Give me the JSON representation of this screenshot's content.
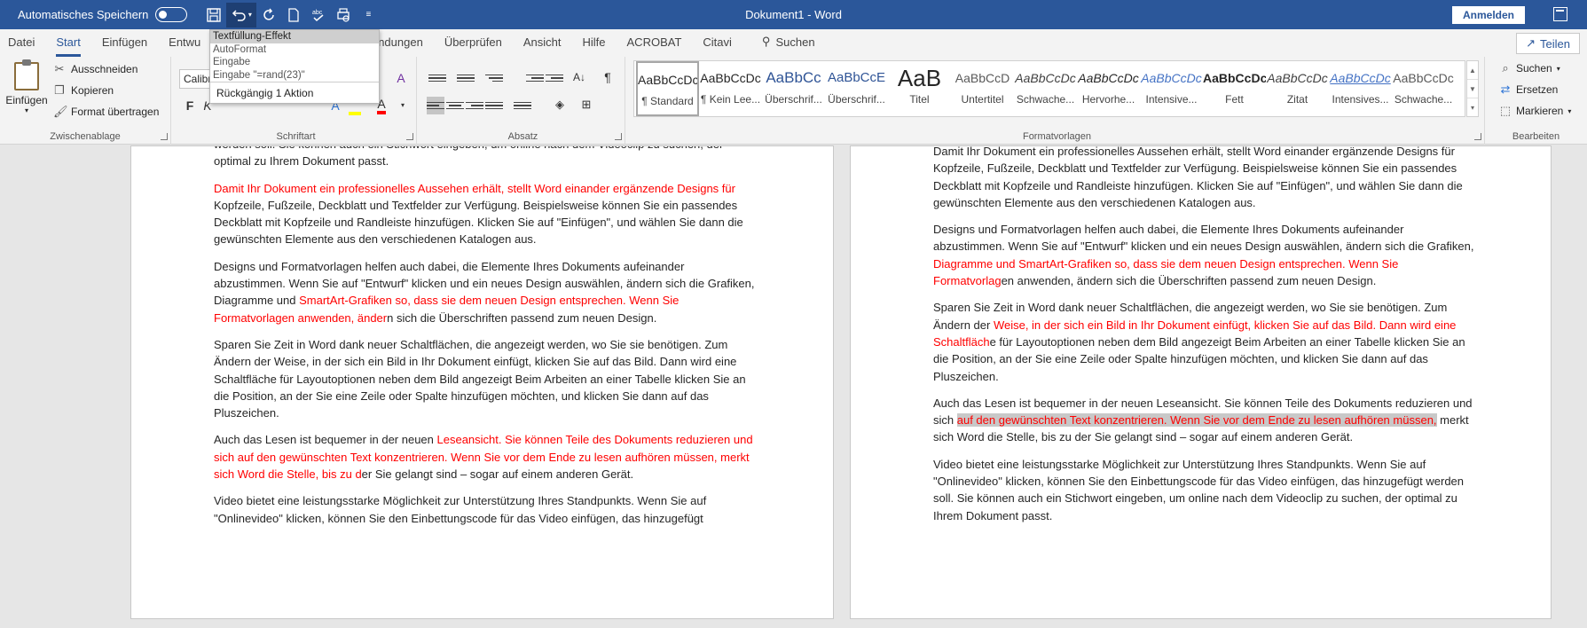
{
  "titlebar": {
    "autosave_label": "Automatisches Speichern",
    "doc_title": "Dokument1  -  Word",
    "signin_label": "Anmelden"
  },
  "undo_dropdown": {
    "items": [
      "Textfüllung-Effekt",
      "AutoFormat",
      "Eingabe",
      "Eingabe \"=rand(23)\""
    ],
    "status": "Rückgängig 1 Aktion"
  },
  "tabs": [
    "Datei",
    "Start",
    "Einfügen",
    "Entwu",
    "Sendungen",
    "Überprüfen",
    "Ansicht",
    "Hilfe",
    "ACROBAT",
    "Citavi"
  ],
  "search_label": "Suchen",
  "share_label": "Teilen",
  "clipboard": {
    "paste_label": "Einfügen",
    "cut_label": "Ausschneiden",
    "copy_label": "Kopieren",
    "format_painter_label": "Format übertragen",
    "group_label": "Zwischenablage"
  },
  "font": {
    "font_name": "Calibri",
    "bold": "F",
    "italic": "K",
    "group_label": "Schriftart"
  },
  "paragraph": {
    "group_label": "Absatz"
  },
  "styles": {
    "group_label": "Formatvorlagen",
    "items": [
      {
        "sample": "AaBbCcDc",
        "name": "¶ Standard"
      },
      {
        "sample": "AaBbCcDc",
        "name": "¶ Kein Lee..."
      },
      {
        "sample": "AaBbCc",
        "name": "Überschrif..."
      },
      {
        "sample": "AaBbCcE",
        "name": "Überschrif..."
      },
      {
        "sample": "AaB",
        "name": "Titel"
      },
      {
        "sample": "AaBbCcD",
        "name": "Untertitel"
      },
      {
        "sample": "AaBbCcDc",
        "name": "Schwache..."
      },
      {
        "sample": "AaBbCcDc",
        "name": "Hervorhe..."
      },
      {
        "sample": "AaBbCcDc",
        "name": "Intensive..."
      },
      {
        "sample": "AaBbCcDc",
        "name": "Fett"
      },
      {
        "sample": "AaBbCcDc",
        "name": "Zitat"
      },
      {
        "sample": "AaBbCcDc",
        "name": "Intensives..."
      },
      {
        "sample": "AaBbCcDc",
        "name": "Schwache..."
      }
    ]
  },
  "editing": {
    "find_label": "Suchen",
    "replace_label": "Ersetzen",
    "select_label": "Markieren",
    "group_label": "Bearbeiten"
  },
  "colors": {
    "titlebar": "#2b579a",
    "tracked_text": "#ff0000",
    "highlight": "#c8c8c8"
  },
  "left_page": {
    "p0": "werden soll. Sie können auch ein Stichwort eingeben, um online nach dem Videoclip zu suchen, der optimal zu Ihrem Dokument passt.",
    "p1_red": "Damit Ihr Dokument ein professionelles Aussehen erhält, stellt Word einander ergänzende Designs für",
    "p1_rest": " Kopfzeile, Fußzeile, Deckblatt und Textfelder zur Verfügung. Beispielsweise können Sie ein passendes Deckblatt mit Kopfzeile und Randleiste hinzufügen. Klicken Sie auf \"Einfügen\", und wählen Sie dann die gewünschten Elemente aus den verschiedenen Katalogen aus.",
    "p2_a": "Designs und Formatvorlagen helfen auch dabei, die Elemente Ihres Dokuments aufeinander abzustimmen. Wenn Sie auf \"Entwurf\" klicken und ein neues Design auswählen, ändern sich die Grafiken, Diagramme und ",
    "p2_red": "SmartArt-Grafiken so, dass sie dem neuen Design entsprechen. Wenn Sie Formatvorlagen anwenden, änder",
    "p2_b": "n sich die Überschriften passend zum neuen Design.",
    "p3": "Sparen Sie Zeit in Word dank neuer Schaltflächen, die angezeigt werden, wo Sie sie benötigen. Zum Ändern der Weise, in der sich ein Bild in Ihr Dokument einfügt, klicken Sie auf das Bild. Dann wird eine Schaltfläche für Layoutoptionen neben dem Bild angezeigt Beim Arbeiten an einer Tabelle klicken Sie an die Position, an der Sie eine Zeile oder Spalte hinzufügen möchten, und klicken Sie dann auf das Pluszeichen.",
    "p4_a": "Auch das Lesen ist bequemer in der neuen ",
    "p4_red": "Leseansicht. Sie können Teile des Dokuments reduzieren und sich auf den gewünschten Text konzentrieren. Wenn Sie vor dem Ende zu lesen aufhören müssen, merkt sich Word die Stelle, bis zu d",
    "p4_b": "er Sie gelangt sind – sogar auf einem anderen Gerät.",
    "p5": "Video bietet eine leistungsstarke Möglichkeit zur Unterstützung Ihres Standpunkts. Wenn Sie auf \"Onlinevideo\" klicken, können Sie den Einbettungscode für das Video einfügen, das hinzugefügt"
  },
  "right_page": {
    "p1": "Damit Ihr Dokument ein professionelles Aussehen erhält, stellt Word einander ergänzende Designs für Kopfzeile, Fußzeile, Deckblatt und Textfelder zur Verfügung. Beispielsweise können Sie ein passendes Deckblatt mit Kopfzeile und Randleiste hinzufügen. Klicken Sie auf \"Einfügen\", und wählen Sie dann die gewünschten Elemente aus den verschiedenen Katalogen aus.",
    "p2_a": "Designs und Formatvorlagen helfen auch dabei, die Elemente Ihres Dokuments aufeinander abzustimmen. Wenn Sie auf \"Entwurf\" klicken und ein neues Design auswählen, ändern sich die Grafiken, ",
    "p2_red": "Diagramme und SmartArt-Grafiken so, dass sie dem neuen Design entsprechen. Wenn Sie Formatvorlag",
    "p2_b": "en anwenden, ändern sich die Überschriften passend zum neuen Design.",
    "p3_a": "Sparen Sie Zeit in Word dank neuer Schaltflächen, die angezeigt werden, wo Sie sie benötigen. Zum Ändern der ",
    "p3_red": "Weise, in der sich ein Bild in Ihr Dokument einfügt, klicken Sie auf das Bild. Dann wird eine Schaltfläch",
    "p3_b": "e für Layoutoptionen neben dem Bild angezeigt Beim Arbeiten an einer Tabelle klicken Sie an die Position, an der Sie eine Zeile oder Spalte hinzufügen möchten, und klicken Sie dann auf das Pluszeichen.",
    "p4_a": "Auch das Lesen ist bequemer in der neuen Leseansicht. Sie können Teile des Dokuments reduzieren und sich ",
    "p4_red": "auf den gewünschten Text konzentrieren. Wenn Sie vor dem Ende zu lesen aufhören müssen,",
    "p4_b": " merkt sich Word die Stelle, bis zu der Sie gelangt sind – sogar auf einem anderen Gerät.",
    "p5": "Video bietet eine leistungsstarke Möglichkeit zur Unterstützung Ihres Standpunkts. Wenn Sie auf \"Onlinevideo\" klicken, können Sie den Einbettungscode für das Video einfügen, das hinzugefügt werden soll. Sie können auch ein Stichwort eingeben, um online nach dem Videoclip zu suchen, der optimal zu Ihrem Dokument passt."
  }
}
